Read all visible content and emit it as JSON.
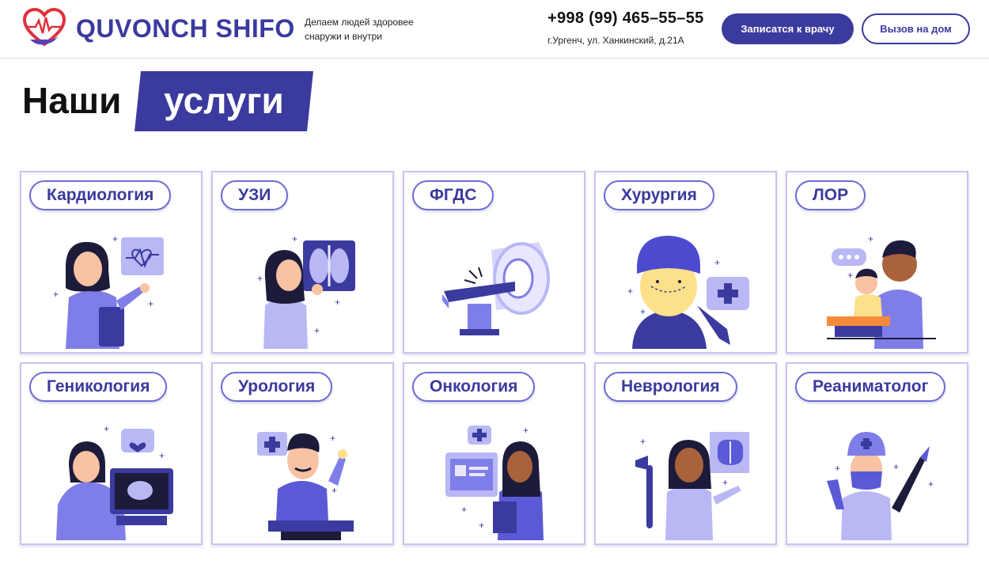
{
  "header": {
    "brand": "QUVONCH SHIFO",
    "tagline": "Делаем людей здоровее снаружи и внутри",
    "phone": "+998 (99) 465–55–55",
    "address": "г.Ургенч, ул. Ханкинский, д.21А",
    "appointment_button": "Записатся к врачу",
    "home_call_button": "Вызов на дом"
  },
  "title": {
    "plain": "Наши",
    "accent": "услуги"
  },
  "services": [
    {
      "label": "Кардиология",
      "icon": "cardiology-doctor-icon"
    },
    {
      "label": "УЗИ",
      "icon": "xray-doctor-icon"
    },
    {
      "label": "ФГДС",
      "icon": "mri-scanner-icon"
    },
    {
      "label": "Хурургия",
      "icon": "surgery-face-icon"
    },
    {
      "label": "ЛОР",
      "icon": "ent-doctor-child-icon"
    },
    {
      "label": "Геникология",
      "icon": "ultrasound-pregnancy-icon"
    },
    {
      "label": "Урология",
      "icon": "urology-doctor-icon"
    },
    {
      "label": "Онкология",
      "icon": "oncology-doctor-icon"
    },
    {
      "label": "Неврология",
      "icon": "neurology-brain-icon"
    },
    {
      "label": "Реаниматолог",
      "icon": "resuscitation-surgeon-icon"
    }
  ],
  "colors": {
    "brand": "#3b3a9e",
    "accent_light": "#8d8cf0",
    "card_border": "#c6c5ef",
    "logo_red": "#e0303a"
  }
}
